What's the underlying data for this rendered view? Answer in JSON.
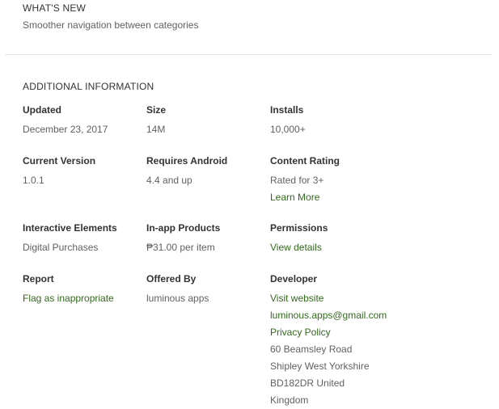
{
  "whats_new": {
    "heading": "WHAT'S NEW",
    "text": "Smoother navigation between categories"
  },
  "additional_info": {
    "heading": "ADDITIONAL INFORMATION",
    "updated": {
      "title": "Updated",
      "value": "December 23, 2017"
    },
    "size": {
      "title": "Size",
      "value": "14M"
    },
    "installs": {
      "title": "Installs",
      "value": "10,000+"
    },
    "current_version": {
      "title": "Current Version",
      "value": "1.0.1"
    },
    "requires_android": {
      "title": "Requires Android",
      "value": "4.4 and up"
    },
    "content_rating": {
      "title": "Content Rating",
      "value": "Rated for 3+",
      "link": "Learn More"
    },
    "interactive_elements": {
      "title": "Interactive Elements",
      "value": "Digital Purchases"
    },
    "in_app_products": {
      "title": "In-app Products",
      "value": "₱31.00 per item"
    },
    "permissions": {
      "title": "Permissions",
      "link": "View details"
    },
    "report": {
      "title": "Report",
      "link": "Flag as inappropriate"
    },
    "offered_by": {
      "title": "Offered By",
      "value": "luminous apps"
    },
    "developer": {
      "title": "Developer",
      "website_link": "Visit website",
      "email_link": "luminous.apps@gmail.com",
      "privacy_link": "Privacy Policy",
      "address_lines": [
        "60 Beamsley Road",
        "Shipley West Yorkshire",
        "BD182DR United",
        "Kingdom"
      ]
    }
  },
  "colors": {
    "link": "#33691e",
    "text": "#333333",
    "muted": "#616161",
    "divider": "#e6e6e6"
  }
}
